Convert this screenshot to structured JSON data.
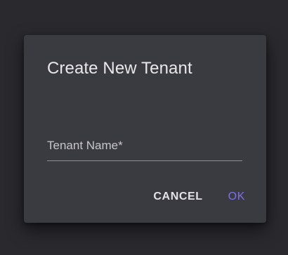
{
  "dialog": {
    "title": "Create New Tenant",
    "field": {
      "label": "Tenant Name*",
      "value": ""
    },
    "actions": {
      "cancel_label": "CANCEL",
      "ok_label": "OK"
    }
  },
  "colors": {
    "backdrop": "#29292e",
    "surface": "#3a3a41",
    "title_text": "#e8e8ea",
    "label_text": "#c6c6cc",
    "underline": "#8d8d94",
    "primary": "#7c6ff0"
  }
}
